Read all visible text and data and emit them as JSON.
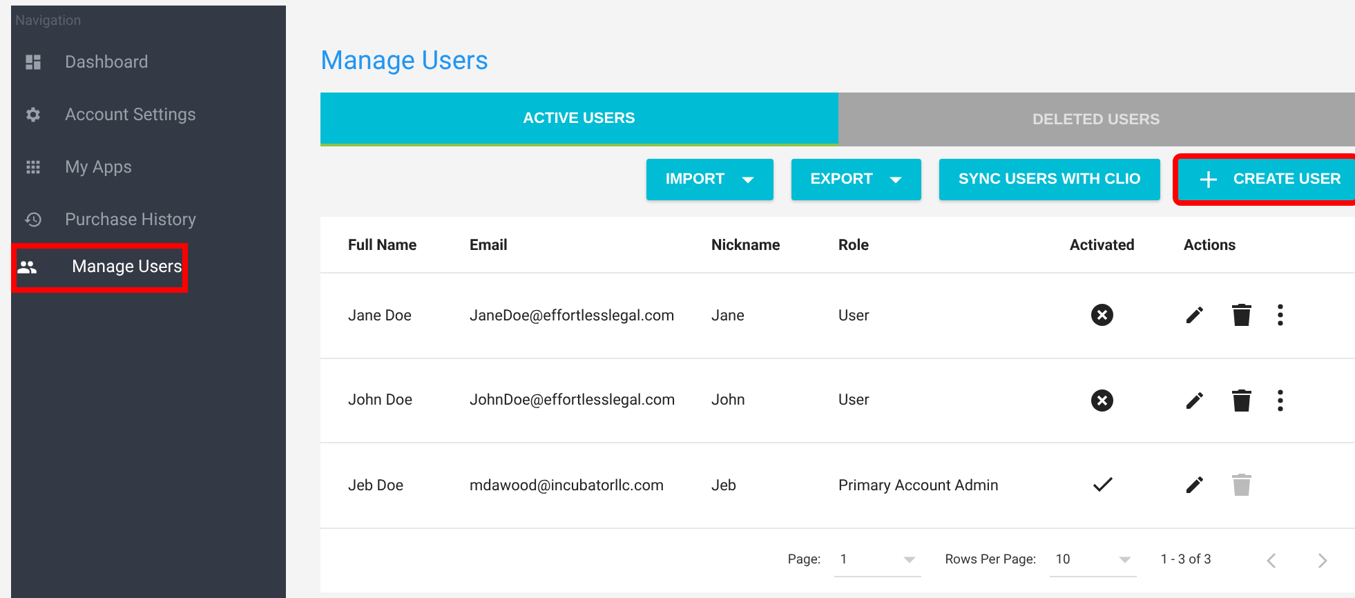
{
  "sidebar": {
    "heading": "Navigation",
    "items": [
      {
        "label": "Dashboard",
        "kind": "dashboard",
        "selected": false,
        "highlighted": false
      },
      {
        "label": "Account Settings",
        "kind": "gear",
        "selected": false,
        "highlighted": false
      },
      {
        "label": "My Apps",
        "kind": "apps",
        "selected": false,
        "highlighted": false
      },
      {
        "label": "Purchase History",
        "kind": "history",
        "selected": false,
        "highlighted": false
      },
      {
        "label": "Manage Users",
        "kind": "people",
        "selected": true,
        "highlighted": true
      }
    ]
  },
  "page_title": "Manage Users",
  "tabs": [
    {
      "label": "ACTIVE USERS",
      "selected": true
    },
    {
      "label": "DELETED USERS",
      "selected": false
    }
  ],
  "toolbar": [
    {
      "label": "IMPORT",
      "kind": "dropdown",
      "highlighted": false
    },
    {
      "label": "EXPORT",
      "kind": "dropdown",
      "highlighted": false
    },
    {
      "label": "SYNC USERS WITH CLIO",
      "kind": "plain",
      "highlighted": false
    },
    {
      "label": "CREATE USER",
      "kind": "add",
      "highlighted": true
    }
  ],
  "table": {
    "columns": [
      "Full Name",
      "Email",
      "Nickname",
      "Role",
      "Activated",
      "Actions"
    ],
    "rows": [
      {
        "full_name": "Jane Doe",
        "email": "JaneDoe@effortlesslegal.com",
        "nickname": "Jane",
        "role": "User",
        "activated": false,
        "delete_disabled": false,
        "menu": true
      },
      {
        "full_name": "John Doe",
        "email": "JohnDoe@effortlesslegal.com",
        "nickname": "John",
        "role": "User",
        "activated": false,
        "delete_disabled": false,
        "menu": true
      },
      {
        "full_name": "Jeb Doe",
        "email": "mdawood@incubatorllc.com",
        "nickname": "Jeb",
        "role": "Primary Account Admin",
        "activated": true,
        "delete_disabled": true,
        "menu": false
      }
    ]
  },
  "pagination": {
    "page_label": "Page:",
    "page": "1",
    "rows_label": "Rows Per Page:",
    "rows": "10",
    "range": "1 - 3 of 3"
  }
}
